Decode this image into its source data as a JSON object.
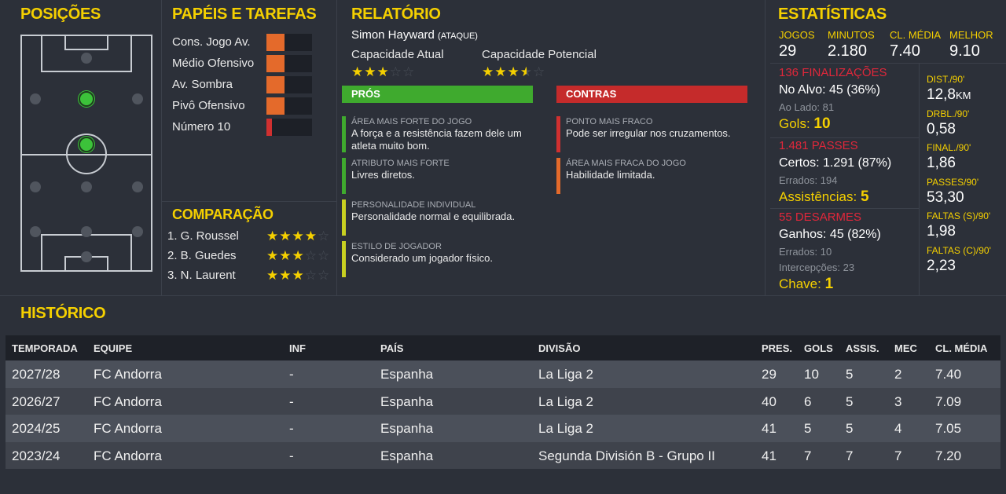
{
  "positions": {
    "title": "POSIÇÕES"
  },
  "roles": {
    "title": "PAPÉIS E TAREFAS",
    "items": [
      {
        "label": "Cons. Jogo Av.",
        "level": 0.4,
        "color": "orange"
      },
      {
        "label": "Médio Ofensivo",
        "level": 0.4,
        "color": "orange"
      },
      {
        "label": "Av. Sombra",
        "level": 0.4,
        "color": "orange"
      },
      {
        "label": "Pivô Ofensivo",
        "level": 0.4,
        "color": "orange"
      },
      {
        "label": "Número 10",
        "level": 0.12,
        "color": "red"
      }
    ]
  },
  "comparison": {
    "title": "COMPARAÇÃO",
    "items": [
      {
        "label": "1. G. Roussel",
        "stars": 4
      },
      {
        "label": "2. B. Guedes",
        "stars": 3
      },
      {
        "label": "3. N. Laurent",
        "stars": 3
      }
    ]
  },
  "report": {
    "title": "RELATÓRIO",
    "player_name": "Simon Hayward",
    "player_role": "(ATAQUE)",
    "current_ability_label": "Capacidade Atual",
    "current_ability_stars": 3,
    "potential_ability_label": "Capacidade Potencial",
    "potential_ability_stars": 3.5,
    "pros_label": "PRÓS",
    "cons_label": "CONTRAS",
    "pros": [
      {
        "label": "ÁREA MAIS FORTE DO JOGO",
        "text": "A força e a resistência fazem dele um atleta muito bom.",
        "color": "#3faa2e"
      },
      {
        "label": "ATRIBUTO MAIS FORTE",
        "text": "Livres diretos.",
        "color": "#3faa2e"
      },
      {
        "label": "PERSONALIDADE INDIVIDUAL",
        "text": "Personalidade normal e equilibrada.",
        "color": "#c8d021"
      },
      {
        "label": "ESTILO DE JOGADOR",
        "text": "Considerado um jogador físico.",
        "color": "#c8d021"
      }
    ],
    "cons": [
      {
        "label": "PONTO MAIS FRACO",
        "text": "Pode ser irregular nos cruzamentos.",
        "color": "#d03030"
      },
      {
        "label": "ÁREA MAIS FRACA DO JOGO",
        "text": "Habilidade limitada.",
        "color": "#e46a2b"
      }
    ],
    "colors": {
      "pros": "#3faa2e",
      "cons": "#c52b2b"
    }
  },
  "stats": {
    "title": "ESTATÍSTICAS",
    "top": [
      {
        "label": "JOGOS",
        "value": "29"
      },
      {
        "label": "MINUTOS",
        "value": "2.180"
      },
      {
        "label": "CL. MÉDIA",
        "value": "7.40"
      },
      {
        "label": "MELHOR",
        "value": "9.10"
      }
    ],
    "shots": {
      "title": "136 FINALIZAÇÕES",
      "on_target": "No Alvo: 45 (36%)",
      "off_target": "Ao Lado: 81",
      "goals_label": "Gols:",
      "goals_value": "10"
    },
    "passes": {
      "title": "1.481 PASSES",
      "completed": "Certos: 1.291 (87%)",
      "missed": "Errados: 194",
      "assists_label": "Assistências:",
      "assists_value": "5"
    },
    "tackles": {
      "title": "55 DESARMES",
      "won": "Ganhos: 45 (82%)",
      "missed": "Errados: 10",
      "interceptions": "Intercepções: 23",
      "key_label": "Chave:",
      "key_value": "1"
    },
    "per90": [
      {
        "label": "DIST./90'",
        "value": "12,8",
        "unit": "KM"
      },
      {
        "label": "DRBL./90'",
        "value": "0,58",
        "unit": ""
      },
      {
        "label": "FINAL./90'",
        "value": "1,86",
        "unit": ""
      },
      {
        "label": "PASSES/90'",
        "value": "53,30",
        "unit": ""
      },
      {
        "label": "FALTAS (S)/90'",
        "value": "1,98",
        "unit": ""
      },
      {
        "label": "FALTAS (C)/90'",
        "value": "2,23",
        "unit": ""
      }
    ]
  },
  "history": {
    "title": "HISTÓRICO",
    "columns": [
      "TEMPORADA",
      "EQUIPE",
      "INF",
      "PAÍS",
      "DIVISÃO",
      "PRES.",
      "GOLS",
      "ASSIS.",
      "MEC",
      "CL. MÉDIA"
    ],
    "rows": [
      [
        "2027/28",
        "FC Andorra",
        "-",
        "Espanha",
        "La Liga 2",
        "29",
        "10",
        "5",
        "2",
        "7.40"
      ],
      [
        "2026/27",
        "FC Andorra",
        "-",
        "Espanha",
        "La Liga 2",
        "40",
        "6",
        "5",
        "3",
        "7.09"
      ],
      [
        "2024/25",
        "FC Andorra",
        "-",
        "Espanha",
        "La Liga 2",
        "41",
        "5",
        "5",
        "4",
        "7.05"
      ],
      [
        "2023/24",
        "FC Andorra",
        "-",
        "Espanha",
        "Segunda División B - Grupo II",
        "41",
        "7",
        "7",
        "7",
        "7.20"
      ]
    ]
  },
  "colors": {
    "accent": "#f5d000",
    "background": "#2c3039",
    "red": "#e0273a"
  }
}
